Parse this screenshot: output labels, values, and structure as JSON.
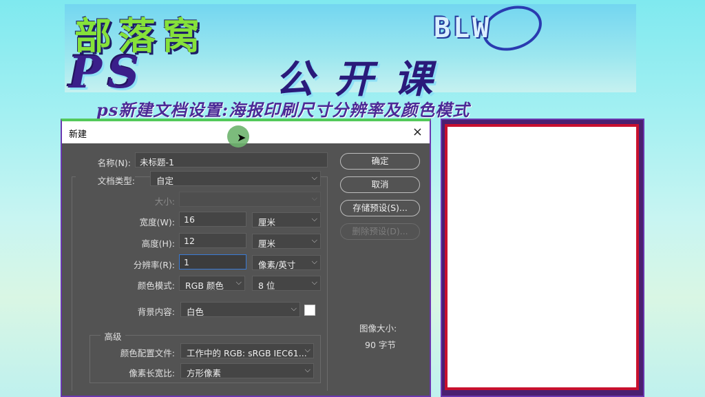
{
  "banner": {
    "title_cn": "部落窝",
    "logo": "BLW",
    "title_ps": "PS",
    "title_open": "公开课",
    "subtitle": "ps新建文档设置:海报印刷尺寸分辨率及颜色模式"
  },
  "dialog": {
    "title": "新建",
    "close": "×",
    "name_label": "名称(N):",
    "name_value": "未标题-1",
    "doctype_label": "文档类型:",
    "doctype_value": "自定",
    "size_label": "大小:",
    "size_value": "",
    "width_label": "宽度(W):",
    "width_value": "16",
    "width_unit": "厘米",
    "height_label": "高度(H):",
    "height_value": "12",
    "height_unit": "厘米",
    "resolution_label": "分辨率(R):",
    "resolution_value": "1",
    "resolution_unit": "像素/英寸",
    "colormode_label": "颜色模式:",
    "colormode_value": "RGB 颜色",
    "bitdepth_value": "8 位",
    "background_label": "背景内容:",
    "background_value": "白色",
    "advanced_label": "高级",
    "profile_label": "颜色配置文件:",
    "profile_value": "工作中的 RGB: sRGB IEC61...",
    "aspect_label": "像素长宽比:",
    "aspect_value": "方形像素",
    "buttons": {
      "ok": "确定",
      "cancel": "取消",
      "save_preset": "存储预设(S)...",
      "delete_preset": "删除预设(D)..."
    },
    "image_size_label": "图像大小:",
    "image_size_value": "90 字节"
  },
  "colors": {
    "dialog_bg": "#535353",
    "accent_blue": "#3a7bd5",
    "preview_border": "#c8102e"
  }
}
